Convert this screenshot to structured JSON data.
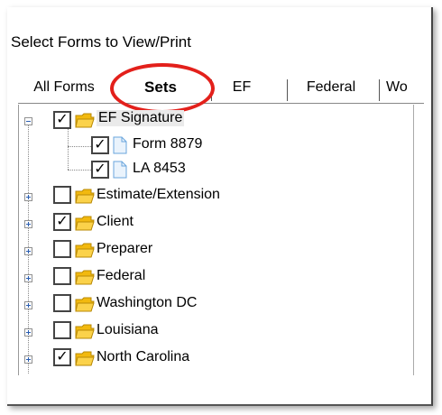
{
  "dialog": {
    "title": "Select Forms to View/Print"
  },
  "tabs": [
    {
      "label": "All Forms",
      "selected": false
    },
    {
      "label": "Sets",
      "selected": true
    },
    {
      "label": "EF",
      "selected": false
    },
    {
      "label": "Federal",
      "selected": false
    },
    {
      "label": "Wo",
      "selected": false
    }
  ],
  "tree": {
    "items": [
      {
        "label": "EF Signature",
        "checked": true,
        "icon": "folder-icon",
        "expanded": true
      },
      {
        "label": "Form 8879",
        "checked": true,
        "icon": "document-icon"
      },
      {
        "label": "LA 8453",
        "checked": true,
        "icon": "document-icon"
      },
      {
        "label": "Estimate/Extension",
        "checked": false,
        "icon": "folder-icon"
      },
      {
        "label": "Client",
        "checked": true,
        "icon": "folder-icon"
      },
      {
        "label": "Preparer",
        "checked": false,
        "icon": "folder-icon"
      },
      {
        "label": "Federal",
        "checked": false,
        "icon": "folder-icon"
      },
      {
        "label": "Washington DC",
        "checked": false,
        "icon": "folder-icon"
      },
      {
        "label": "Louisiana",
        "checked": false,
        "icon": "folder-icon"
      },
      {
        "label": "North Carolina",
        "checked": true,
        "icon": "folder-icon"
      }
    ]
  },
  "colors": {
    "highlight_circle": "#e3201b",
    "folder": "#f2b90f",
    "document": "#6aa6dd"
  },
  "checkmark": "✓"
}
